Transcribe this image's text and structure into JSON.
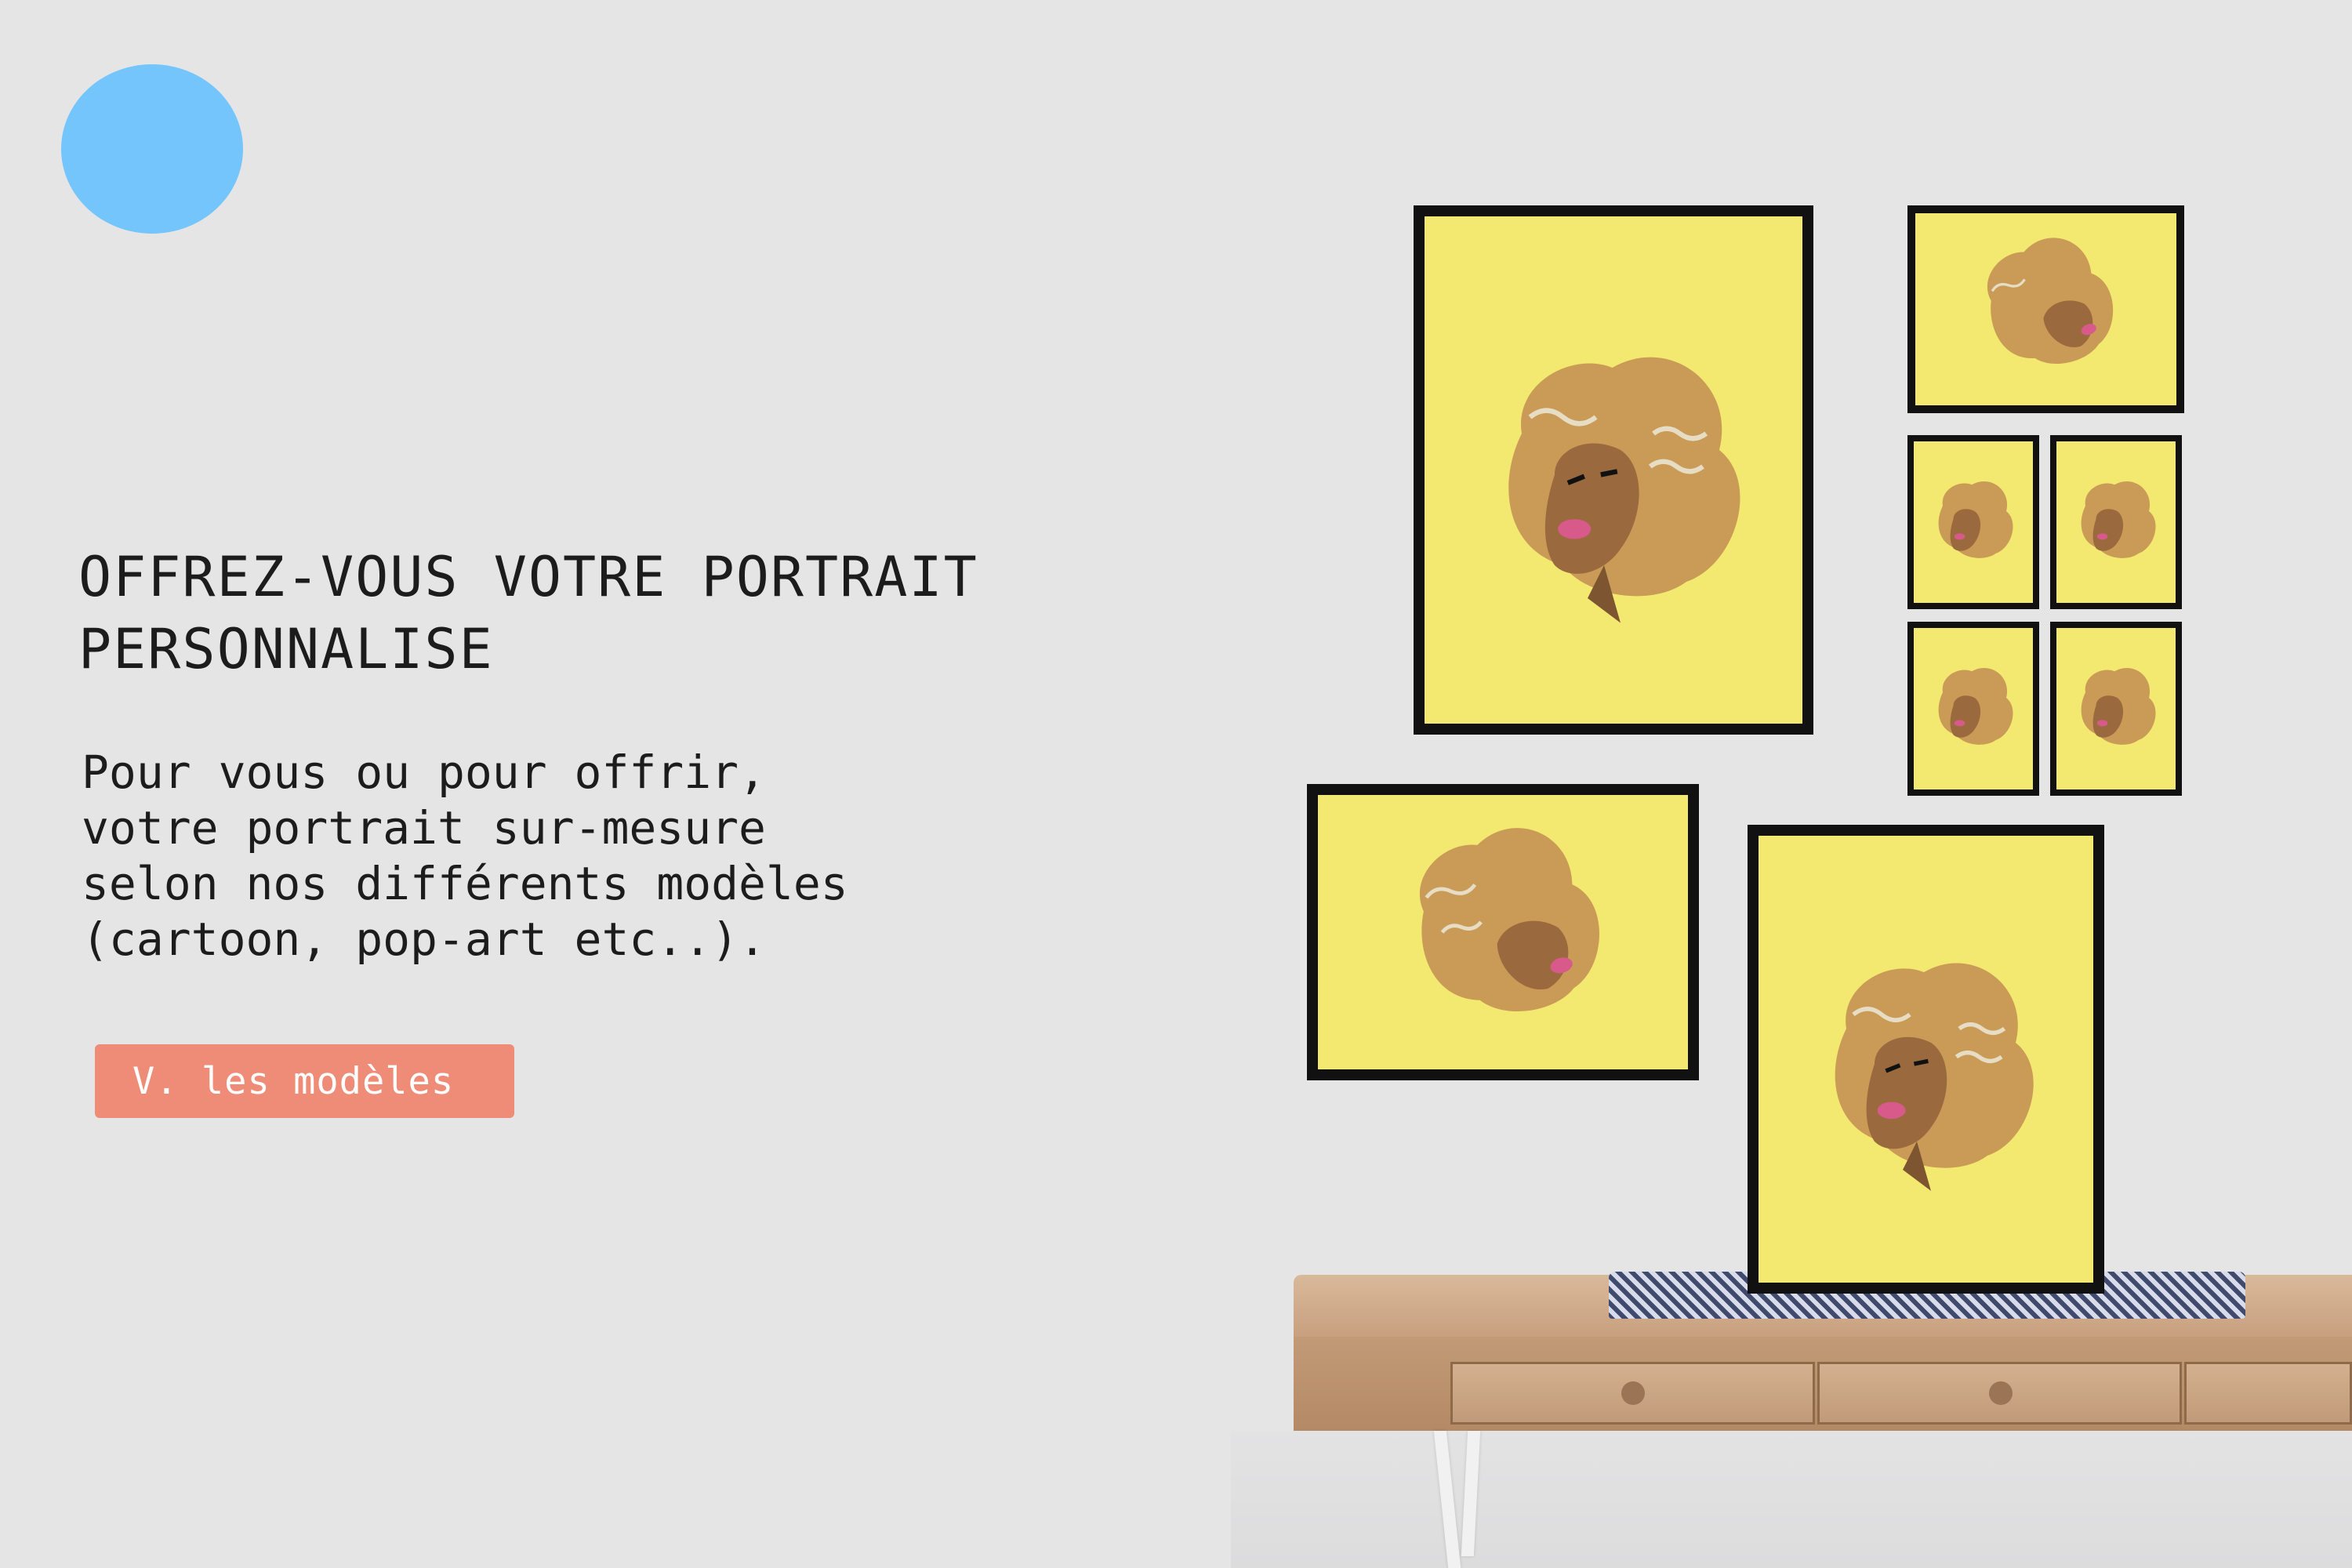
{
  "brand": {
    "logo_icon": "circle-logo-icon",
    "color": "#74c5fb"
  },
  "hero": {
    "title_lines": [
      "OFFREZ-VOUS VOTRE PORTRAIT",
      "PERSONNALISE"
    ],
    "text_lines": [
      "Pour vous ou pour offrir,",
      "votre portrait sur-mesure",
      "selon nos différents modèles",
      "(cartoon, pop-art etc..)."
    ],
    "cta_label": "V. les modèles",
    "cta_color": "#ef8c78"
  },
  "scene": {
    "art_background": "#f3e970",
    "frame_color": "#111111",
    "subject": "portrait-illustration-icon",
    "furniture": "wooden-desk"
  }
}
